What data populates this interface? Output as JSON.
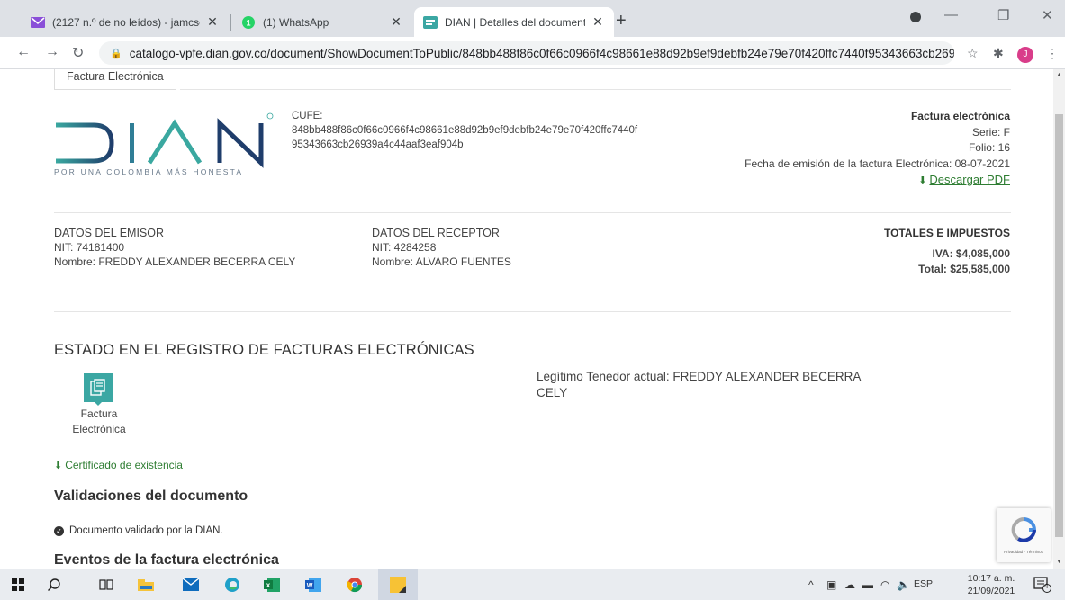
{
  "browser": {
    "tabs": [
      {
        "title": "(2127 n.º de no leídos) - jamcsol...",
        "icon": "gmail-icon"
      },
      {
        "title": "(1) WhatsApp",
        "icon": "whatsapp-icon"
      },
      {
        "title": "DIAN | Detalles del documento",
        "icon": "dian-icon",
        "active": true
      }
    ],
    "address": "catalogo-vpfe.dian.gov.co/document/ShowDocumentToPublic/848bb488f86c0f66c0966f4c98661e88d92b9ef9debfb24e79e70f420ffc7440f95343663cb26939a4...",
    "profile_initial": "J"
  },
  "page": {
    "section_tab": "Factura Electrónica",
    "logo_text": "DIAN",
    "logo_tagline": "POR UNA COLOMBIA MÁS HONESTA",
    "cufe_label": "CUFE:",
    "cufe_value_1": "848bb488f86c0f66c0966f4c98661e88d92b9ef9debfb24e79e70f420ffc7440f",
    "cufe_value_2": "95343663cb26939a4c44aaf3eaf904b",
    "invoice": {
      "title": "Factura electrónica",
      "serie": "Serie: F",
      "folio": "Folio: 16",
      "fecha": "Fecha de emisión de la factura Electrónica: 08-07-2021",
      "download": "Descargar PDF"
    },
    "emisor": {
      "heading": "DATOS DEL EMISOR",
      "nit": "NIT: 74181400",
      "nombre": "Nombre: FREDDY ALEXANDER BECERRA CELY"
    },
    "receptor": {
      "heading": "DATOS DEL RECEPTOR",
      "nit": "NIT: 4284258",
      "nombre": "Nombre: ALVARO FUENTES"
    },
    "totales": {
      "heading": "TOTALES E IMPUESTOS",
      "iva": "IVA: $4,085,000",
      "total": "Total: $25,585,000"
    },
    "estado_title": "ESTADO EN EL REGISTRO DE FACTURAS ELECTRÓNICAS",
    "doc_label_1": "Factura",
    "doc_label_2": "Electrónica",
    "tenedor": "Legítimo Tenedor actual: FREDDY ALEXANDER BECERRA CELY",
    "certificado": "Certificado de existencia",
    "validaciones_title": "Validaciones del documento",
    "validacion_item": "Documento validado por la DIAN.",
    "eventos_title": "Eventos de la factura electrónica",
    "recaptcha_text": "Privacidad - Términos"
  },
  "taskbar": {
    "lang": "ESP",
    "time": "10:17 a. m.",
    "date": "21/09/2021",
    "notifications": "4"
  },
  "colors": {
    "dian_teal": "#3ba7a3",
    "dian_navy": "#1f2f5c",
    "link_green": "#2e7d32"
  }
}
